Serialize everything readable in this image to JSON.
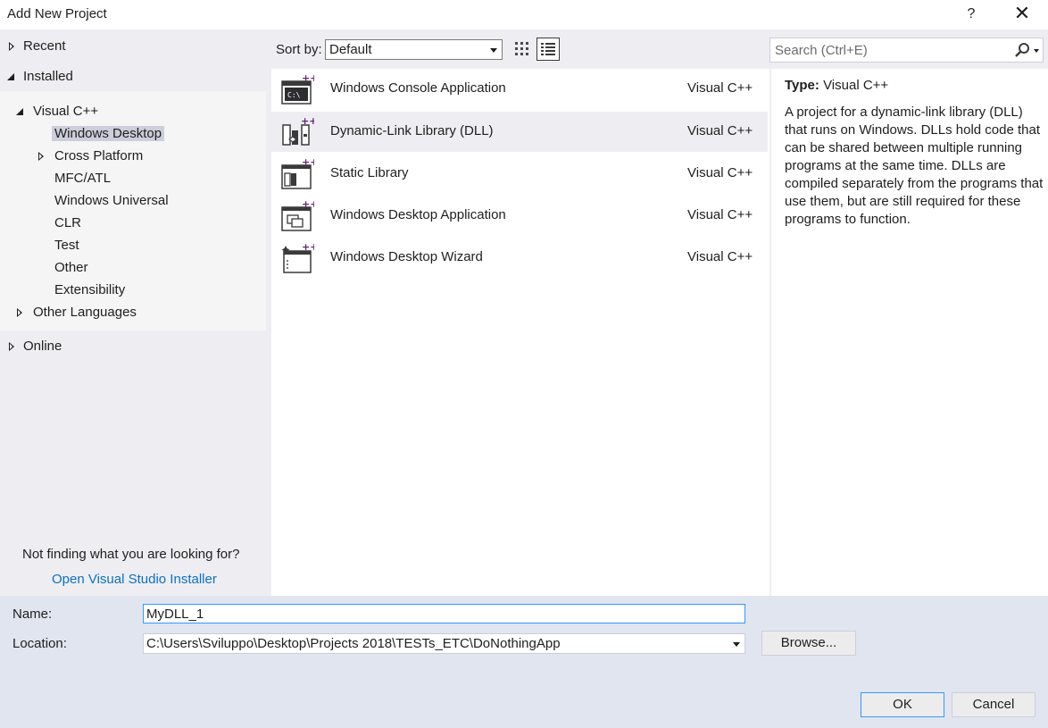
{
  "window": {
    "title": "Add New Project",
    "help_label": "?",
    "close_label": "✕"
  },
  "sidebar": {
    "recent": "Recent",
    "installed": "Installed",
    "visual_cpp": "Visual C++",
    "children": [
      "Windows Desktop",
      "Cross Platform",
      "MFC/ATL",
      "Windows Universal",
      "CLR",
      "Test",
      "Other",
      "Extensibility"
    ],
    "selected": "Windows Desktop",
    "other_languages": "Other Languages",
    "online": "Online",
    "not_finding": "Not finding what you are looking for?",
    "installer_link": "Open Visual Studio Installer"
  },
  "toolbar": {
    "sort_label": "Sort by:",
    "sort_value": "Default",
    "search_placeholder": "Search (Ctrl+E)"
  },
  "templates": [
    {
      "name": "Windows Console Application",
      "lang": "Visual C++",
      "icon": "console-app-icon"
    },
    {
      "name": "Dynamic-Link Library (DLL)",
      "lang": "Visual C++",
      "icon": "dll-icon"
    },
    {
      "name": "Static Library",
      "lang": "Visual C++",
      "icon": "static-library-icon"
    },
    {
      "name": "Windows Desktop Application",
      "lang": "Visual C++",
      "icon": "desktop-app-icon"
    },
    {
      "name": "Windows Desktop Wizard",
      "lang": "Visual C++",
      "icon": "desktop-wizard-icon"
    }
  ],
  "selected_template_index": 1,
  "description": {
    "type_label": "Type:",
    "type_value": "Visual C++",
    "text": "A project for a dynamic-link library (DLL) that runs on Windows. DLLs hold code that can be shared between multiple running programs at the same time. DLLs are compiled separately from the programs that use them, but are still required for these programs to function."
  },
  "form": {
    "name_label": "Name:",
    "name_value": "MyDLL_1",
    "location_label": "Location:",
    "location_value": "C:\\Users\\Sviluppo\\Desktop\\Projects 2018\\TESTs_ETC\\DoNothingApp",
    "browse_label": "Browse...",
    "ok_label": "OK",
    "cancel_label": "Cancel"
  },
  "colors": {
    "accent_purple": "#68217a",
    "link_blue": "#0e70c0",
    "focus_blue": "#3399ff"
  }
}
